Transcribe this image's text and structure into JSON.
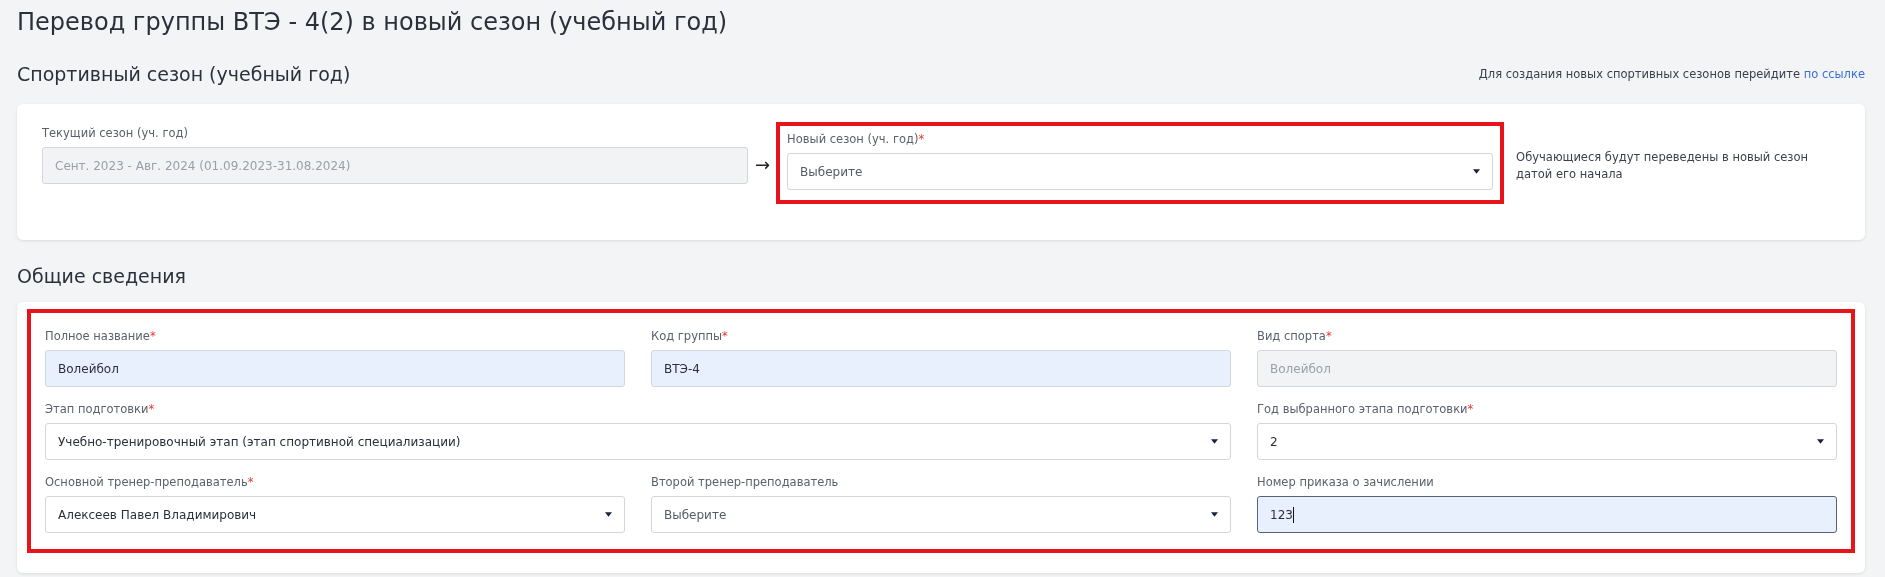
{
  "page_title": "Перевод группы ВТЭ - 4(2) в новый сезон (учебный год)",
  "season_section": {
    "title": "Спортивный сезон (учебный год)",
    "hint": "Для создания новых спортивных сезонов перейдите",
    "hint_link": "по ссылке",
    "current": {
      "label": "Текущий сезон (уч. год)",
      "kind": "input",
      "value": "Сент. 2023 - Авг. 2024 (01.09.2023-31.08.2024)",
      "disabled": true,
      "focused": false
    },
    "arrow": "→",
    "new": {
      "label": "Новый сезон (уч. год)",
      "required_mark": "*",
      "kind": "select",
      "placeholder": "Выберите",
      "disabled": false,
      "highlighted": true
    },
    "note": "Обучающиеся будут переведены в новый сезон датой его начала"
  },
  "general_section": {
    "title": "Общие сведения",
    "highlighted": true,
    "rows": [
      [
        {
          "label": "Полное название",
          "required_mark": "*",
          "kind": "input",
          "value": "Волейбол",
          "disabled": false,
          "autofilled": true,
          "focused": false
        },
        {
          "label": "Код группы",
          "required_mark": "*",
          "kind": "input",
          "value": "ВТЭ-4",
          "disabled": false,
          "autofilled": true,
          "focused": false
        },
        {
          "label": "Вид спорта",
          "required_mark": "*",
          "kind": "input",
          "value": "Волейбол",
          "disabled": true,
          "autofilled": false,
          "focused": false
        }
      ],
      [
        {
          "label": "Этап подготовки",
          "required_mark": "*",
          "kind": "select",
          "value": "Учебно-тренировочный этап (этап спортивной специализации)",
          "disabled": false,
          "colspan": 2
        },
        {
          "label": "Год выбранного этапа подготовки",
          "required_mark": "*",
          "kind": "select",
          "value": "2",
          "disabled": false
        }
      ],
      [
        {
          "label": "Основной тренер-преподаватель",
          "required_mark": "*",
          "kind": "select",
          "value": "Алексеев Павел Владимирович",
          "disabled": false
        },
        {
          "label": "Второй тренер-преподаватель",
          "kind": "select",
          "placeholder": "Выберите",
          "disabled": false
        },
        {
          "label": "Номер приказа о зачислении",
          "kind": "input",
          "value": "123",
          "disabled": false,
          "autofilled": true,
          "focused": true
        }
      ]
    ]
  }
}
